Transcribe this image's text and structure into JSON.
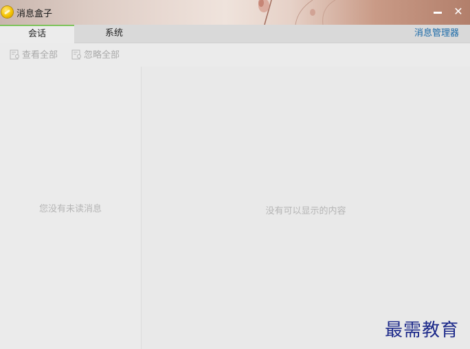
{
  "window": {
    "title": "消息盒子",
    "minimize_symbol": "",
    "close_symbol": "✕"
  },
  "tabs": {
    "session": "会话",
    "system": "系统",
    "manager_link": "消息管理器"
  },
  "toolbar": {
    "view_all": "查看全部",
    "ignore_all": "忽略全部"
  },
  "left_panel": {
    "empty_text": "您没有未读消息"
  },
  "right_panel": {
    "empty_text": "没有可以显示的内容"
  },
  "watermark": "最需教育",
  "colors": {
    "active_tab_accent": "#7cc35a",
    "link": "#1a6aa8",
    "watermark": "#1d2a8a"
  }
}
